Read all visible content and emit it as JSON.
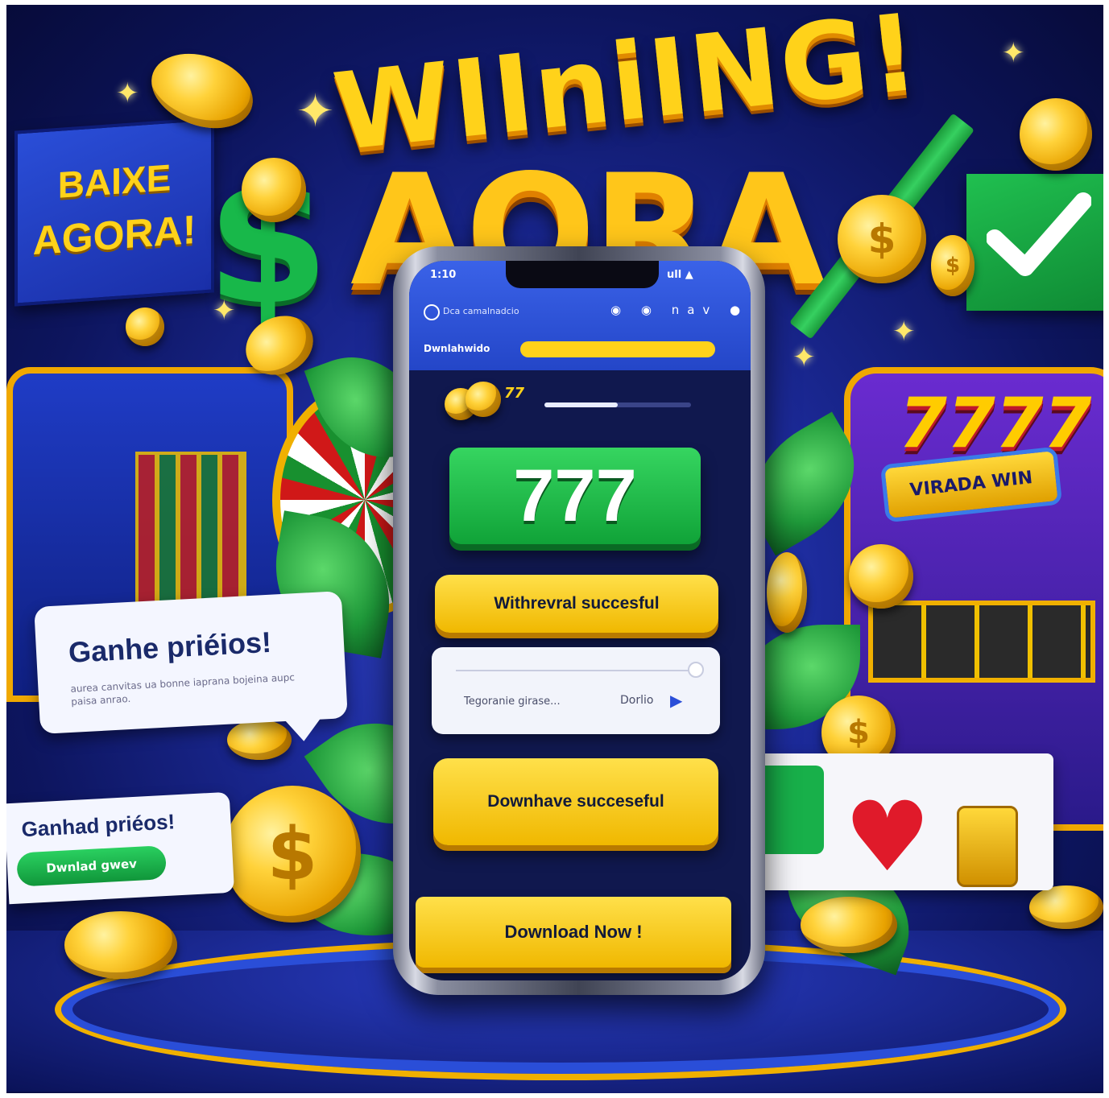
{
  "headline": {
    "line1": "WIIniING!",
    "line2": "AORA"
  },
  "baixe_sign": {
    "line1": "BAIXE",
    "line2": "AGORA!"
  },
  "slot_right": {
    "number": "7777",
    "banner": "VIRADA WIN"
  },
  "callout_left": {
    "title": "Ganhe priéios!",
    "subtitle": "aurea canvitas ua bonne iaprana bojeina aupc paisa anrao."
  },
  "callout_bottom": {
    "title": "Ganhad priéos!",
    "button": "Dwnlad gwev"
  },
  "phone": {
    "status_left": "1:10",
    "status_right": "ull ▲",
    "app_title": "Dca camalnadcio",
    "app_icons": "◉ ◉ nav ●",
    "tab_label": "Dwnlahwido",
    "mini_label": "77",
    "progress": 0.5,
    "big_number": "777",
    "withdrawal_label": "Withrevral succesful",
    "panel_text": "Tegoranie girase...",
    "panel_button": "Dorlio",
    "download_ok_label": "Downhave succeseful",
    "download_now_label": "Download Now !"
  },
  "colors": {
    "accent_yellow": "#ffd21a",
    "accent_green": "#18b84a",
    "deep_blue": "#1c2a9a"
  }
}
